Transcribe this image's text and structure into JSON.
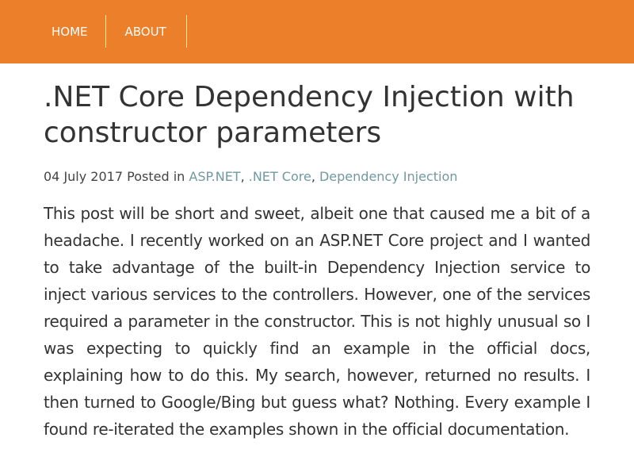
{
  "nav": {
    "items": [
      {
        "label": "HOME"
      },
      {
        "label": "ABOUT"
      }
    ]
  },
  "post": {
    "title": ".NET Core Dependency Injection with constructor parameters",
    "date": "04 July 2017",
    "posted_in": "Posted in",
    "categories": [
      {
        "label": "ASP.NET"
      },
      {
        "label": ".NET Core"
      },
      {
        "label": "Dependency Injection"
      }
    ],
    "body": "This post will be short and sweet, albeit one that caused me a bit of a headache. I recently worked on an ASP.NET Core project and I wanted to take advantage of the built-in Dependency Injection service to inject various services to the controllers. However, one of the services required a parameter in the constructor. This is not highly unusual so I was expecting to quickly find an example in the official docs, explaining how to do this. My search, however, returned no results. I then turned to Google/Bing but guess what? Nothing. Every example I found re-iterated the examples shown in the official documentation."
  },
  "colors": {
    "header_bg": "#ec7f2a",
    "link": "#6e9aa0",
    "text": "#333333"
  }
}
